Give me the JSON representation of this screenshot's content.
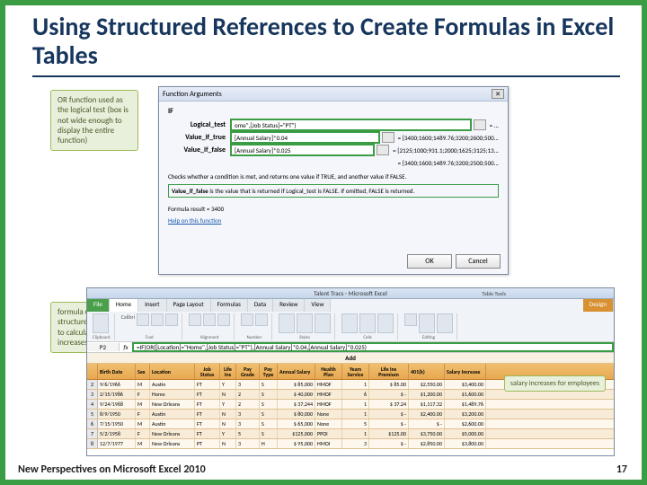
{
  "slide": {
    "title": "Using Structured References to Create Formulas in Excel Tables",
    "footer": "New Perspectives on Microsoft Excel 2010",
    "page": "17"
  },
  "callouts": {
    "c1": "OR function used as the logical test (box is not wide enough to display the entire function)",
    "c2": "formula uses structured references to calculate the salary increases",
    "c3": "salary increases for employees"
  },
  "dialog": {
    "title": "Function Arguments",
    "close": "✕",
    "if_label": "IF",
    "rows": {
      "logical": {
        "label": "Logical_test",
        "value": "ome\",[Job Status]=\"PT\")",
        "result": "= ..."
      },
      "true": {
        "label": "Value_if_true",
        "value": "[Annual Salary]*0.04",
        "result": "= {3400;1600;1489.76;3200;2600;500..."
      },
      "false": {
        "label": "Value_if_false",
        "value": "[Annual Salary]*0.025",
        "result": "= {2125;1000;931.1;2000;1625;3125;13..."
      }
    },
    "equals": "= {3400;1600;1489.76;3200;2500;500...",
    "desc": "Checks whether a condition is met, and returns one value if TRUE, and another value if FALSE.",
    "desc2_label": "Value_if_false",
    "desc2_text": "is the value that is returned if Logical_test is FALSE. If omitted, FALSE is returned.",
    "result_label": "Formula result =",
    "result_value": "3400",
    "help": "Help on this function",
    "ok": "OK",
    "cancel": "Cancel"
  },
  "excel": {
    "window_title": "Talent Tracs - Microsoft Excel",
    "tabletools": "Table Tools",
    "tabs": [
      "File",
      "Home",
      "Insert",
      "Page Layout",
      "Formulas",
      "Data",
      "Review",
      "View",
      "Design"
    ],
    "groups": [
      "Clipboard",
      "Font",
      "Alignment",
      "Number",
      "Styles",
      "Cells",
      "Editing"
    ],
    "font": "Calibri",
    "cell_ref": "P2",
    "fx": "fx",
    "formula": "=IF(OR([Location]=\"Home\",[Job Status]=\"PT\"),[Annual Salary]*0.04,[Annual Salary]*0.025)",
    "title_word": "Add",
    "headers": [
      "",
      "Birth Date",
      "Sex",
      "Location",
      "Job Status",
      "Life Ins",
      "Pay Grade",
      "Pay Type",
      "Annual Salary",
      "Health Plan",
      "Years Service",
      "Life Ins Premium",
      "401(k)",
      "Salary Increase"
    ],
    "rownums": [
      "2",
      "3",
      "4",
      "5",
      "6",
      "7",
      "8"
    ]
  },
  "chart_data": {
    "type": "table",
    "columns": [
      "Birth Date",
      "Sex",
      "Location",
      "Job Status",
      "Life Ins",
      "Pay Grade",
      "Pay Type",
      "Annual Salary",
      "Health Plan",
      "Years Service",
      "Life Ins Premium",
      "401(k)",
      "Salary Increase"
    ],
    "rows": [
      [
        "9/6/1966",
        "M",
        "Austin",
        "FT",
        "Y",
        "3",
        "S",
        "$ 85,000",
        "HMOF",
        "1",
        "$ 85.00",
        "$2,550.00",
        "$3,400.00"
      ],
      [
        "2/15/1986",
        "F",
        "Home",
        "FT",
        "N",
        "2",
        "S",
        "$ 40,000",
        "HMOF",
        "6",
        "$ -",
        "$1,200.00",
        "$1,600.00"
      ],
      [
        "9/24/1968",
        "M",
        "New Orleans",
        "FT",
        "Y",
        "2",
        "S",
        "$ 37,244",
        "HMOF",
        "1",
        "$ 37.24",
        "$1,117.32",
        "$1,489.76"
      ],
      [
        "8/9/1950",
        "F",
        "Austin",
        "FT",
        "N",
        "3",
        "S",
        "$ 80,000",
        "None",
        "1",
        "$ -",
        "$2,400.00",
        "$3,200.00"
      ],
      [
        "7/15/1950",
        "M",
        "Austin",
        "FT",
        "N",
        "3",
        "S",
        "$ 65,000",
        "None",
        "5",
        "$ -",
        "$ -",
        "$2,600.00"
      ],
      [
        "5/2/1958",
        "F",
        "New Orleans",
        "FT",
        "Y",
        "5",
        "S",
        "$125,000",
        "PPOI",
        "1",
        "$125.00",
        "$3,750.00",
        "$5,000.00"
      ],
      [
        "12/7/1977",
        "M",
        "New Orleans",
        "PT",
        "N",
        "3",
        "H",
        "$ 95,000",
        "HMOI",
        "3",
        "$ -",
        "$2,850.00",
        "$3,800.00"
      ]
    ]
  }
}
